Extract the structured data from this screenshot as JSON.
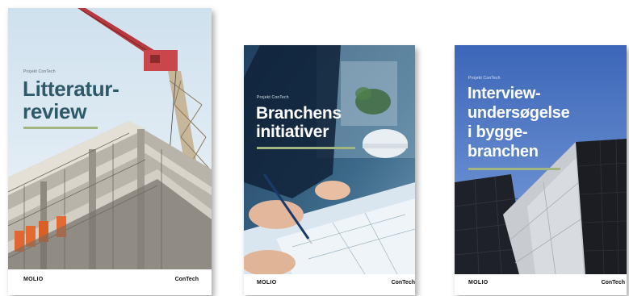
{
  "covers": [
    {
      "eyebrow": "Projekt ConTech",
      "title": "Litteratur-\nreview",
      "title_color": "#2e5968",
      "rule_color": "#a3b57e",
      "logo_left": "MOLIO",
      "logo_right": "ConTech"
    },
    {
      "eyebrow": "Projekt ConTech",
      "title": "Branchens\ninitiativer",
      "title_color": "#ffffff",
      "rule_color": "#a3b57e",
      "logo_left": "MOLIO",
      "logo_right": "ConTech"
    },
    {
      "eyebrow": "Projekt ConTech",
      "title": "Interview-\nundersøgelse\ni bygge-\nbranchen",
      "title_color": "#ffffff",
      "rule_color": "#a3b57e",
      "logo_left": "MOLIO",
      "logo_right": "ConTech"
    }
  ]
}
